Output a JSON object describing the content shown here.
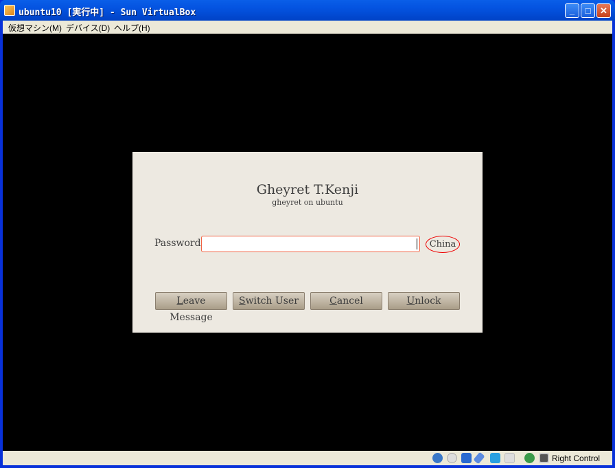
{
  "window": {
    "title": "ubuntu10 [実行中] - Sun VirtualBox",
    "minimize": "_",
    "maximize": "□",
    "close": "✕"
  },
  "menu": [
    "仮想マシン(M)",
    "デバイス(D)",
    "ヘルプ(H)"
  ],
  "dialog": {
    "user_name": "Gheyret T.Kenji",
    "user_host": "gheyret on ubuntu",
    "password_label": "Password:",
    "password_value": "",
    "keyboard_layout": "China",
    "buttons": [
      {
        "mnemonic": "L",
        "rest": "eave Message"
      },
      {
        "mnemonic": "S",
        "rest": "witch User"
      },
      {
        "mnemonic": "C",
        "rest": "ancel"
      },
      {
        "mnemonic": "U",
        "rest": "nlock"
      }
    ]
  },
  "status": {
    "host_key": "Right Control",
    "icons": [
      "hard-disk-icon",
      "cd-icon",
      "network-icon",
      "usb-icon",
      "shared-folder-icon",
      "vrdp-icon",
      "mouse-integration-icon",
      "host-key-icon"
    ]
  }
}
